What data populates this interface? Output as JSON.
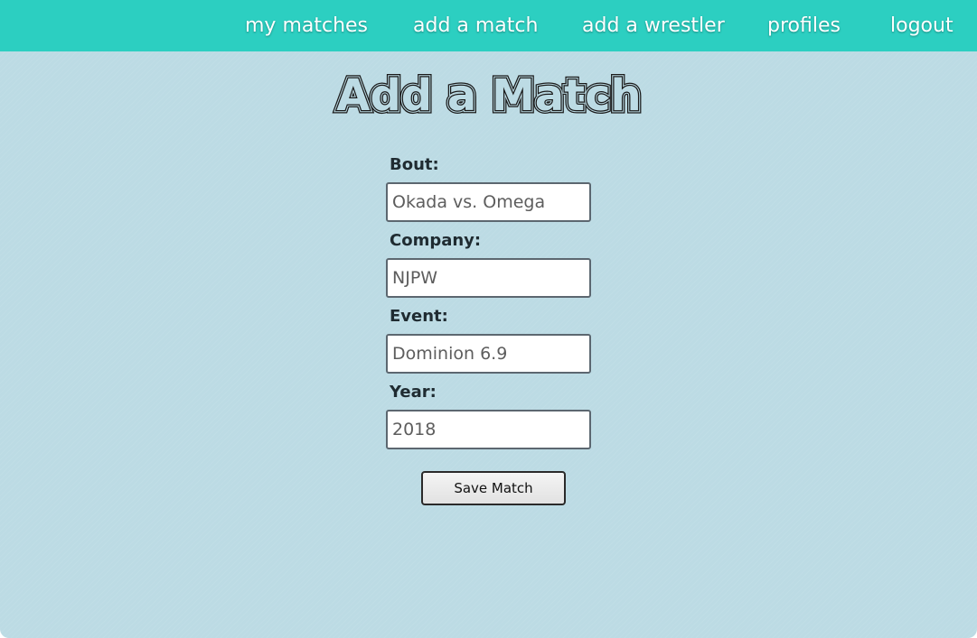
{
  "nav": {
    "items": [
      {
        "label": "my matches"
      },
      {
        "label": "add a match"
      },
      {
        "label": "add a wrestler"
      },
      {
        "label": "profiles"
      },
      {
        "label": "logout"
      }
    ]
  },
  "page": {
    "title": "Add a Match"
  },
  "form": {
    "bout": {
      "label": "Bout:",
      "value": "Okada vs. Omega"
    },
    "company": {
      "label": "Company:",
      "value": "NJPW"
    },
    "event": {
      "label": "Event:",
      "value": "Dominion 6.9"
    },
    "year": {
      "label": "Year:",
      "value": "2018"
    },
    "submit_label": "Save Match"
  },
  "colors": {
    "navbar": "#2ccfc1",
    "background": "#bcdbe4",
    "title": "#1a1a1a"
  }
}
